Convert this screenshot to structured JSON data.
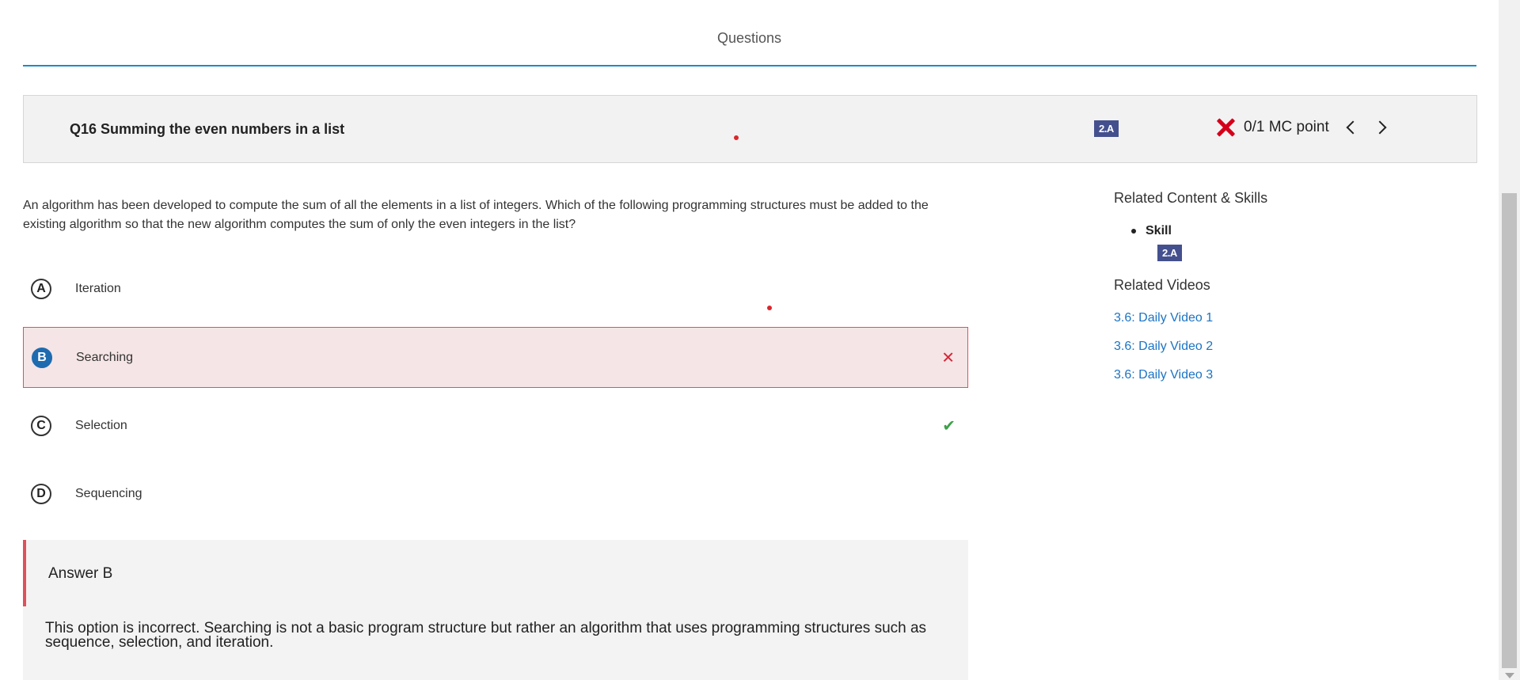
{
  "header": {
    "tab_label": "Questions"
  },
  "question_bar": {
    "title": "Q16 Summing the even numbers in a list",
    "skill_badge": "2.A",
    "score": "0/1 MC point"
  },
  "question": {
    "text": "An algorithm has been developed to compute the sum of all the elements in a list of integers. Which of the following programming structures must be added to the existing algorithm so that the new algorithm computes the sum of only the even integers in the list?"
  },
  "options": [
    {
      "letter": "A",
      "label": "Iteration",
      "state": "none"
    },
    {
      "letter": "B",
      "label": "Searching",
      "state": "selected-incorrect"
    },
    {
      "letter": "C",
      "label": "Selection",
      "state": "correct"
    },
    {
      "letter": "D",
      "label": "Sequencing",
      "state": "none"
    }
  ],
  "answer": {
    "title": "Answer B",
    "explanation": "This option is incorrect. Searching is not a basic program structure but rather an algorithm that uses programming structures such as sequence, selection, and iteration."
  },
  "sidebar": {
    "related_heading": "Related Content & Skills",
    "skill_label": "Skill",
    "skill_badge": "2.A",
    "videos_heading": "Related Videos",
    "videos": [
      "3.6: Daily Video 1",
      "3.6: Daily Video 2",
      "3.6: Daily Video 3"
    ]
  },
  "colors": {
    "accent_blue": "#1b8bc7",
    "badge_navy": "#44508e",
    "incorrect_red": "#d4001a",
    "correct_green": "#3fa04a",
    "link_blue": "#1b74c4"
  }
}
